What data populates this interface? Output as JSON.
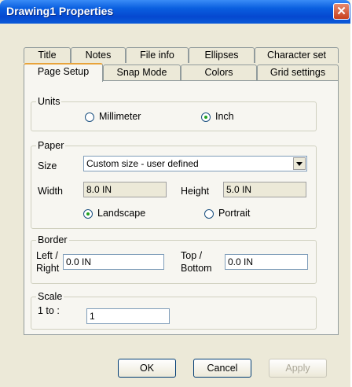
{
  "window": {
    "title": "Drawing1 Properties",
    "close_symbol": "✕"
  },
  "tabs": {
    "row_top": [
      "Title",
      "Notes",
      "File info",
      "Ellipses",
      "Character set"
    ],
    "row_bottom": [
      "Page Setup",
      "Snap Mode",
      "Colors",
      "Grid settings"
    ],
    "active": "Page Setup"
  },
  "units": {
    "label": "Units",
    "option_mm": "Millimeter",
    "option_inch": "Inch",
    "selected": "Inch"
  },
  "paper": {
    "label": "Paper",
    "size_label": "Size",
    "size_value": "Custom size - user defined",
    "width_label": "Width",
    "width_value": "8.0 IN",
    "height_label": "Height",
    "height_value": "5.0 IN",
    "landscape_label": "Landscape",
    "portrait_label": "Portrait",
    "orientation": "Landscape"
  },
  "border": {
    "label": "Border",
    "lr_label_1": "Left /",
    "lr_label_2": "Right",
    "lr_value": "0.0 IN",
    "tb_label_1": "Top /",
    "tb_label_2": "Bottom",
    "tb_value": "0.0 IN"
  },
  "scale": {
    "label": "Scale",
    "ratio_label": "1 to :",
    "value": "1"
  },
  "buttons": {
    "ok": "OK",
    "cancel": "Cancel",
    "apply": "Apply"
  }
}
